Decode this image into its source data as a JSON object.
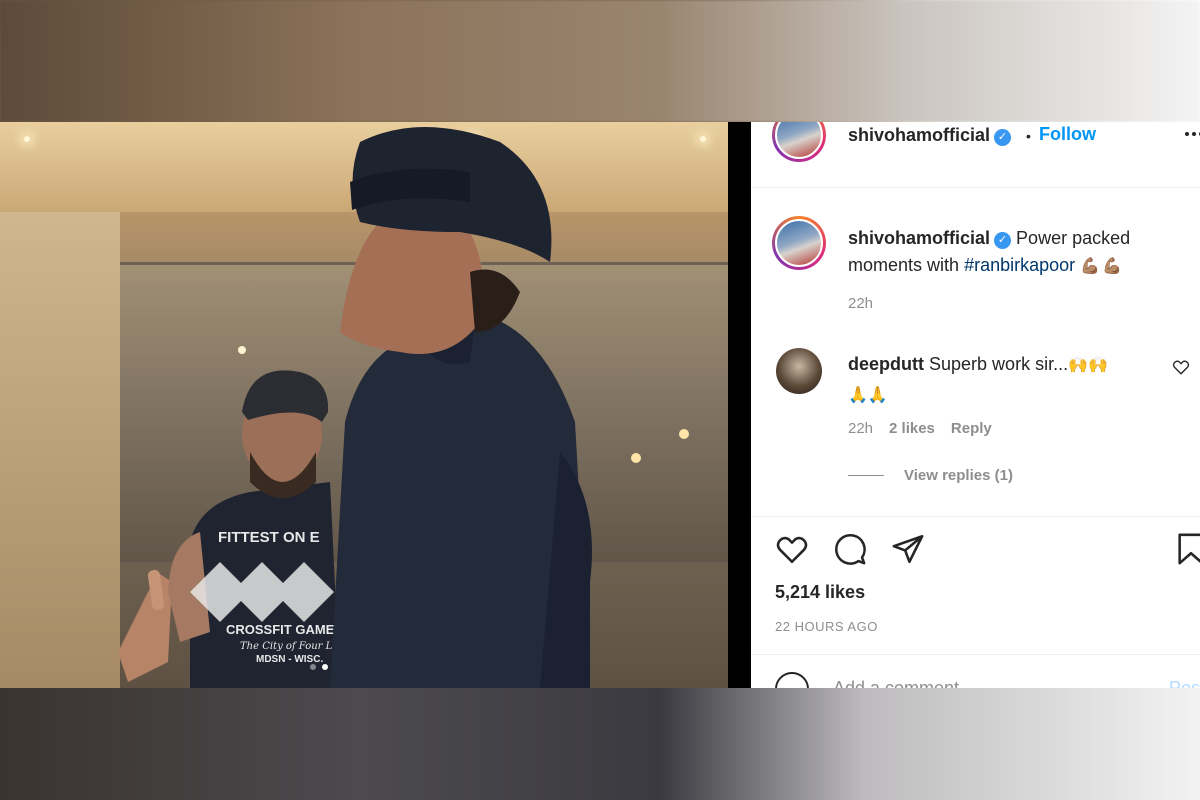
{
  "post": {
    "username": "shivohamofficial",
    "follow_label": "Follow",
    "separator": "•",
    "caption_text": "Power packed moments with",
    "caption_hashtag": "#ranbirkapoor",
    "caption_emoji": "💪🏽💪🏽",
    "caption_time": "22h",
    "likes": "5,214 likes",
    "timestamp": "22 HOURS AGO",
    "add_comment_placeholder": "Add a comment…",
    "post_button": "Post",
    "carousel": {
      "count": 2,
      "active_index": 1
    }
  },
  "comment": {
    "username": "deepdutt",
    "text": "Superb work sir...",
    "emoji_line1": "🙌🙌",
    "emoji_line2": "🙏🙏",
    "time": "22h",
    "likes": "2 likes",
    "reply_label": "Reply",
    "view_replies": "View replies (1)"
  },
  "photo": {
    "shirt_text_1": "FITTEST ON E",
    "shirt_text_2": "CROSSFIT GAMES",
    "shirt_text_3": "The City of Four L",
    "shirt_text_4": "MDSN - WISC."
  },
  "icons": {
    "verified": "verified-badge-icon",
    "like": "heart-icon",
    "comment": "comment-icon",
    "share": "send-icon",
    "save": "bookmark-icon",
    "more": "more-options-icon"
  },
  "colors": {
    "accent": "#0095f6",
    "hashtag": "#00376b",
    "text": "#262626",
    "muted": "#8e8e8e",
    "verified": "#3897f0"
  }
}
